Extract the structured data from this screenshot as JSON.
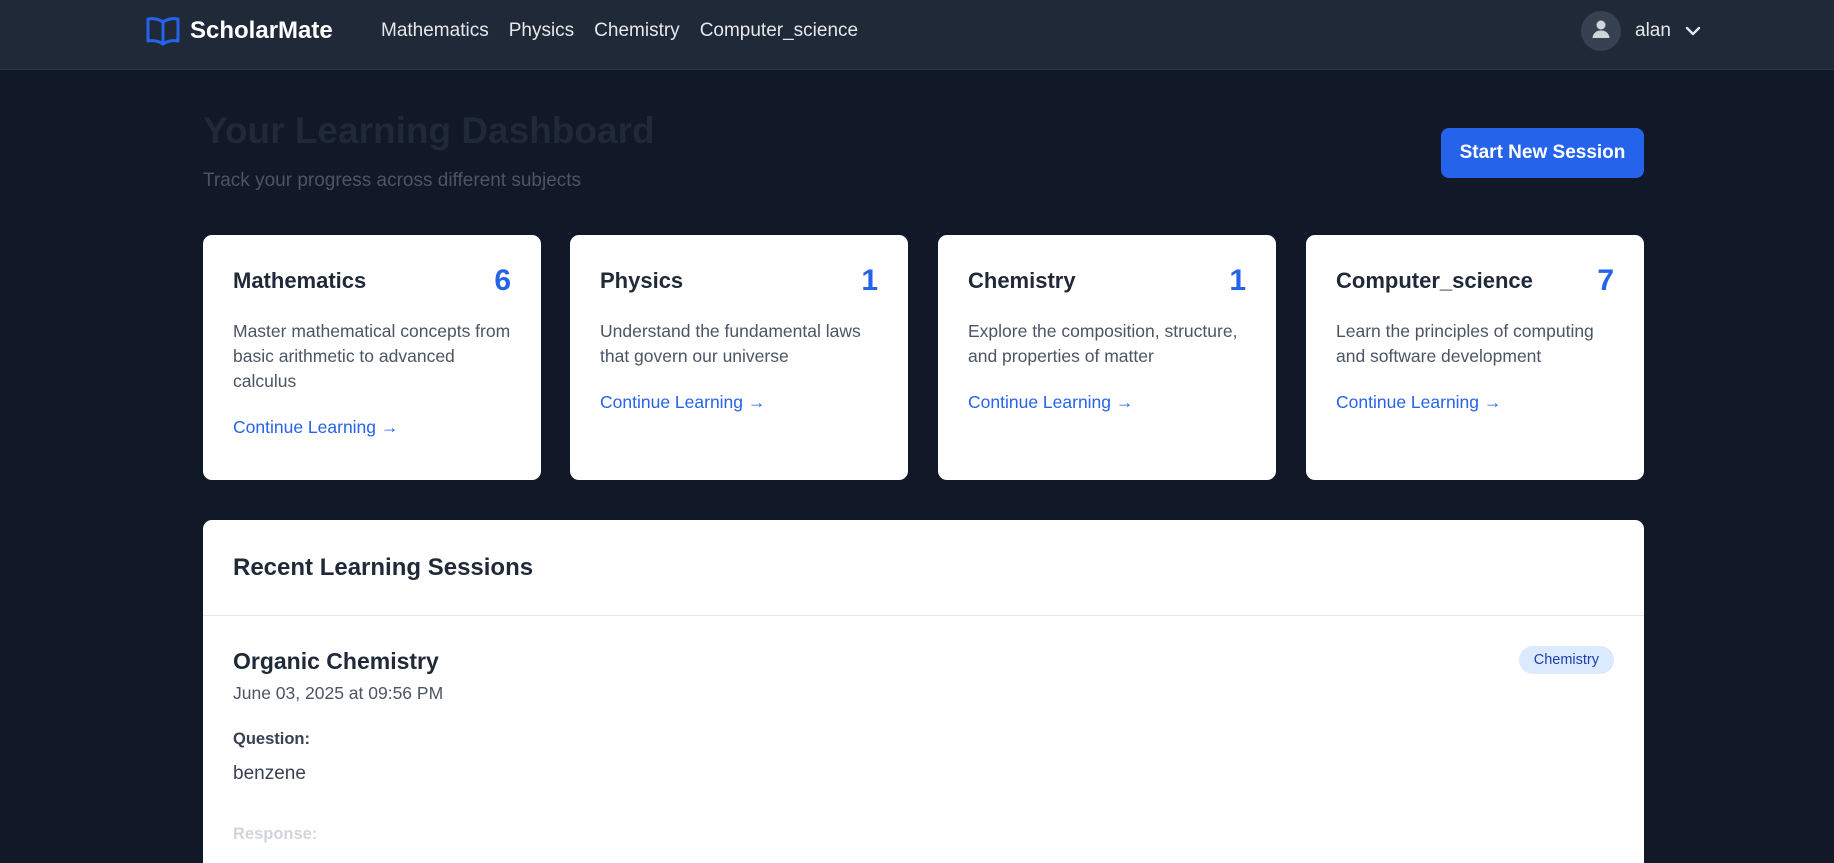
{
  "brand": {
    "name": "ScholarMate",
    "icon": "book-open-icon",
    "color": "#2563eb"
  },
  "nav": {
    "links": [
      "Mathematics",
      "Physics",
      "Chemistry",
      "Computer_science"
    ]
  },
  "user": {
    "name": "alan",
    "icon": "user-icon",
    "menu_icon": "chevron-down-icon"
  },
  "header": {
    "title": "Your Learning Dashboard",
    "subtitle": "Track your progress across different subjects",
    "start_button": "Start New Session"
  },
  "subjects": [
    {
      "title": "Mathematics",
      "count": "6",
      "description": "Master mathematical concepts from basic arithmetic to advanced calculus",
      "link": "Continue Learning →"
    },
    {
      "title": "Physics",
      "count": "1",
      "description": "Understand the fundamental laws that govern our universe",
      "link": "Continue Learning →"
    },
    {
      "title": "Chemistry",
      "count": "1",
      "description": "Explore the composition, structure, and properties of matter",
      "link": "Continue Learning →"
    },
    {
      "title": "Computer_science",
      "count": "7",
      "description": "Learn the principles of computing and software development",
      "link": "Continue Learning →"
    }
  ],
  "recent": {
    "title": "Recent Learning Sessions",
    "sessions": [
      {
        "title": "Organic Chemistry",
        "date": "June 03, 2025 at 09:56 PM",
        "badge": "Chemistry",
        "question_label": "Question:",
        "question": "benzene",
        "response_label": "Response:"
      }
    ]
  },
  "colors": {
    "background": "#111827",
    "navbar": "#1f2937",
    "accent": "#2563eb",
    "badge_bg": "#dbeafe"
  }
}
